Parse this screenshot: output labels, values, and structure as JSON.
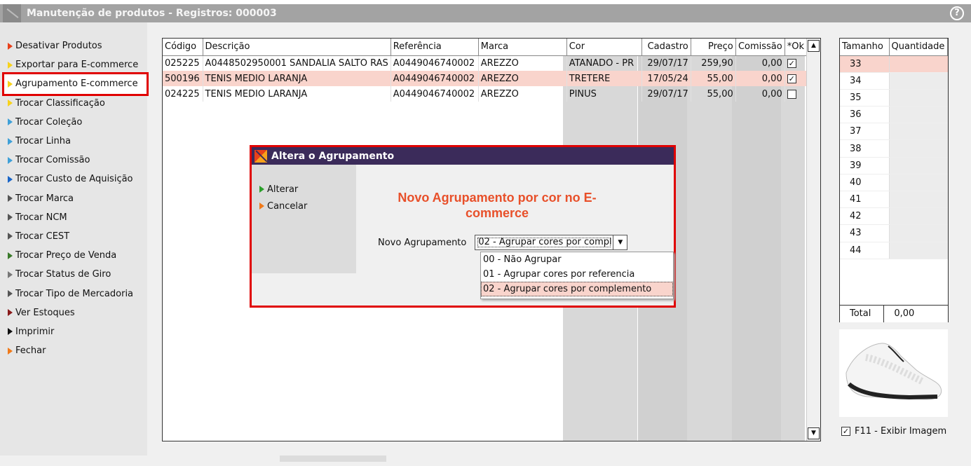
{
  "window": {
    "title": "Manutenção de produtos - Registros: 000003",
    "help_icon": "question-circle-icon"
  },
  "menu": [
    {
      "label": "Desativar Produtos",
      "color": "#e8401a"
    },
    {
      "label": "Exportar para E-commerce",
      "color": "#f7d21b"
    },
    {
      "label": "Agrupamento E-commerce",
      "color": "#f7d21b"
    },
    {
      "label": "Trocar Classificação",
      "color": "#f7d21b"
    },
    {
      "label": "Trocar Coleção",
      "color": "#3fa0d8"
    },
    {
      "label": "Trocar Linha",
      "color": "#3fa0d8"
    },
    {
      "label": "Trocar Comissão",
      "color": "#3fa0d8"
    },
    {
      "label": "Trocar Custo de Aquisição",
      "color": "#1a66c8"
    },
    {
      "label": "Trocar Marca",
      "color": "#555555"
    },
    {
      "label": "Trocar NCM",
      "color": "#555555"
    },
    {
      "label": "Trocar CEST",
      "color": "#555555"
    },
    {
      "label": "Trocar Preço de Venda",
      "color": "#3a7a2a"
    },
    {
      "label": "Trocar Status de Giro",
      "color": "#777777"
    },
    {
      "label": "Trocar Tipo de Mercadoria",
      "color": "#555555"
    },
    {
      "label": "Ver Estoques",
      "color": "#8a1a1a"
    },
    {
      "label": "Imprimir",
      "color": "#111111"
    },
    {
      "label": "Fechar",
      "color": "#f07a1a"
    }
  ],
  "grid": {
    "headers": [
      "Código",
      "Descrição",
      "Referência",
      "Marca",
      "Cor",
      "Cadastro",
      "Preço",
      "Comissão",
      "*Ok"
    ],
    "rows": [
      {
        "codigo": "025225",
        "descricao": "A0448502950001 SANDALIA SALTO RAS",
        "referencia": "A0449046740002",
        "marca": "AREZZO",
        "cor": "ATANADO - PR",
        "cadastro": "29/07/17",
        "preco": "259,90",
        "comissao": "0,00",
        "ok": true
      },
      {
        "codigo": "500196",
        "descricao": "TENIS MEDIO LARANJA",
        "referencia": "A0449046740002",
        "marca": "AREZZO",
        "cor": "TRETERE",
        "cadastro": "17/05/24",
        "preco": "55,00",
        "comissao": "0,00",
        "ok": true
      },
      {
        "codigo": "024225",
        "descricao": "TENIS MEDIO LARANJA",
        "referencia": "A0449046740002",
        "marca": "AREZZO",
        "cor": "PINUS",
        "cadastro": "29/07/17",
        "preco": "55,00",
        "comissao": "0,00",
        "ok": false
      }
    ]
  },
  "sizes": {
    "headers": [
      "Tamanho",
      "Quantidade"
    ],
    "values": [
      "33",
      "34",
      "35",
      "36",
      "37",
      "38",
      "39",
      "40",
      "41",
      "42",
      "43",
      "44"
    ],
    "total_label": "Total",
    "total_value": "0,00"
  },
  "image_toggle": {
    "label": "F11 - Exibir Imagem",
    "checked": true
  },
  "dialog": {
    "title": "Altera o Agrupamento",
    "actions": [
      {
        "label": "Alterar",
        "color": "#2aa02a"
      },
      {
        "label": "Cancelar",
        "color": "#f07a1a"
      }
    ],
    "heading": "Novo Agrupamento por cor no E-commerce",
    "field_label": "Novo Agrupamento",
    "selected": "02 - Agrupar cores por compl",
    "options": [
      "00 - Não Agrupar",
      "01 - Agrupar cores por referencia",
      "02 - Agrupar cores por complemento"
    ]
  }
}
